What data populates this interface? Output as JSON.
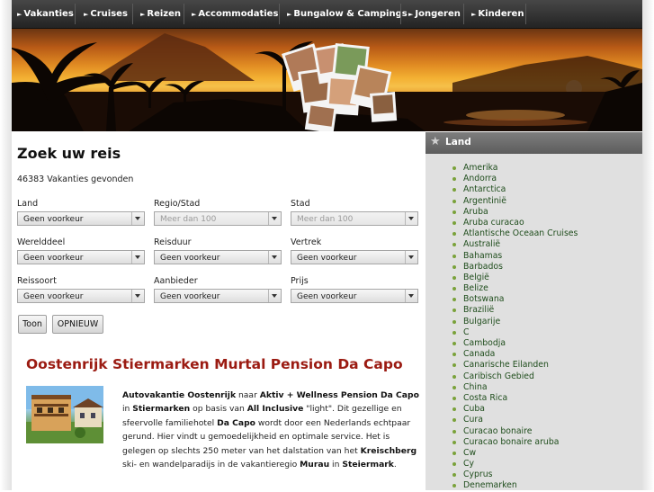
{
  "nav": {
    "items": [
      "Vakanties",
      "Cruises",
      "Reizen",
      "Accommodaties",
      "Bungalow & Campings",
      "Jongeren",
      "Kinderen"
    ]
  },
  "search": {
    "title": "Zoek uw reis",
    "result_count": "46383 Vakanties gevonden",
    "fields": {
      "land": {
        "label": "Land",
        "value": "Geen voorkeur"
      },
      "regio": {
        "label": "Regio/Stad",
        "value": "Meer dan 100"
      },
      "stad": {
        "label": "Stad",
        "value": "Meer dan 100"
      },
      "werelddeel": {
        "label": "Werelddeel",
        "value": "Geen voorkeur"
      },
      "reisduur": {
        "label": "Reisduur",
        "value": "Geen voorkeur"
      },
      "vertrek": {
        "label": "Vertrek",
        "value": "Geen voorkeur"
      },
      "reissoort": {
        "label": "Reissoort",
        "value": "Geen voorkeur"
      },
      "aanbieder": {
        "label": "Aanbieder",
        "value": "Geen voorkeur"
      },
      "prijs": {
        "label": "Prijs",
        "value": "Geen voorkeur"
      }
    },
    "show_button": "Toon",
    "reset_button": "OPNIEUW"
  },
  "offer": {
    "title": "Oostenrijk Stiermarken Murtal Pension Da Capo",
    "desc": {
      "b1": "Autovakantie Oostenrijk",
      "t1": " naar ",
      "b2": "Aktiv + Wellness Pension Da Capo",
      "t2": " in ",
      "b3": "Stiermarken",
      "t3": " op basis van ",
      "b4": "All Inclusive",
      "t4": " \"light\".  Dit gezellige en sfeervolle familiehotel ",
      "b5": "Da Capo",
      "t5": " wordt door een Nederlands echtpaar gerund. Hier vindt u gemoedelijkheid en optimale service. Het is gelegen op slechts 250 meter van het dalstation van het ",
      "b6": "Kreischberg",
      "t6": " ski- en wandelparadijs in de vakantieregio ",
      "b7": "Murau",
      "t7": " in ",
      "b8": "Steiermark",
      "t8": "."
    }
  },
  "sidebar": {
    "title": "Land",
    "countries": [
      "Amerika",
      "Andorra",
      "Antarctica",
      "Argentinië",
      "Aruba",
      "Aruba curacao",
      "Atlantische Oceaan Cruises",
      "Australië",
      "Bahamas",
      "Barbados",
      "België",
      "Belize",
      "Botswana",
      "Brazilië",
      "Bulgarije",
      "C",
      "Cambodja",
      "Canada",
      "Canarische Eilanden",
      "Caribisch Gebied",
      "China",
      "Costa Rica",
      "Cuba",
      "Cura",
      "Curacao bonaire",
      "Curacao bonaire aruba",
      "Cw",
      "Cy",
      "Cyprus",
      "Denemarken"
    ]
  },
  "colors": {
    "nav_bg": "#2d2d2d",
    "offer_title": "#9b1b12",
    "link_green": "#1f4d1c",
    "sidebar_bg": "#e0e0e0",
    "sidebar_head": "#6b6b6b"
  },
  "icons": {
    "nav_arrow": "triangle-right-icon",
    "sidebar_star": "star-icon",
    "select": "chevron-down-icon"
  }
}
